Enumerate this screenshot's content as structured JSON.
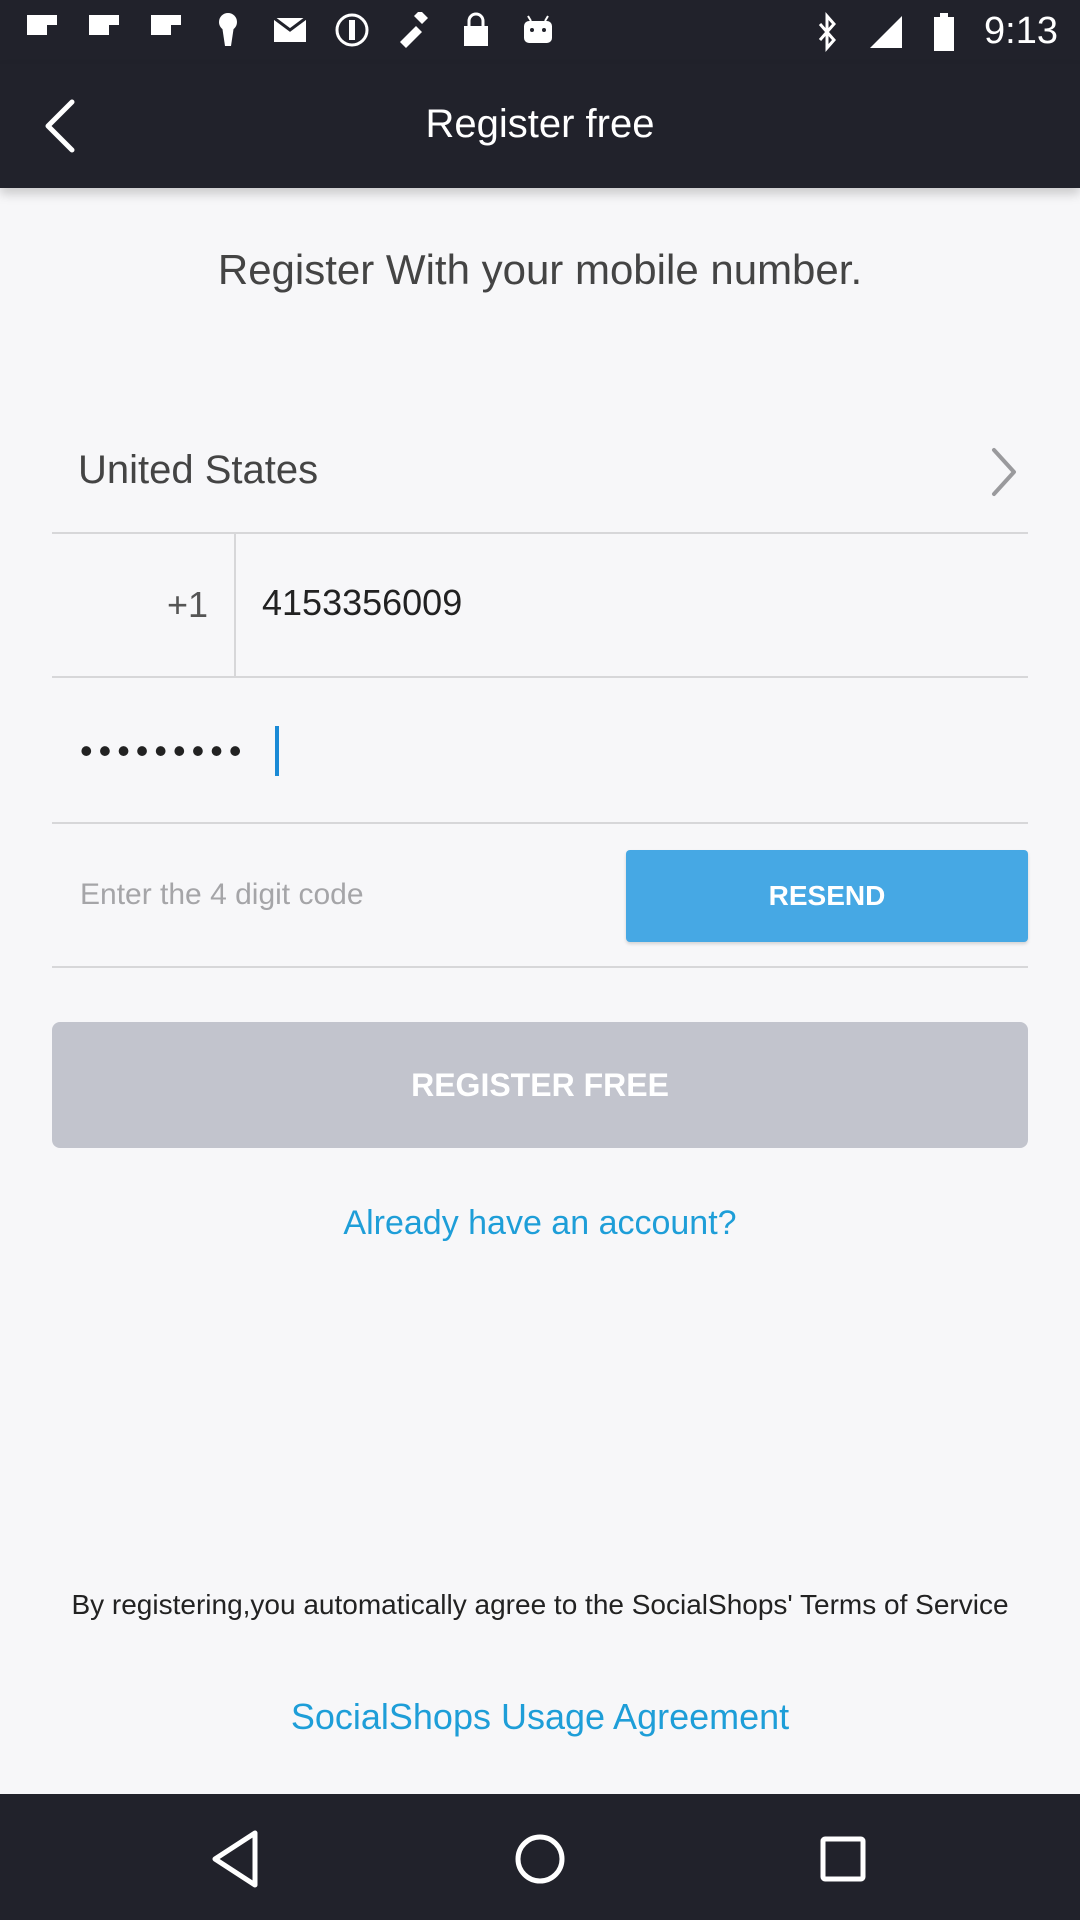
{
  "status_bar": {
    "time": "9:13",
    "left_icons": [
      "flipboard-icon",
      "flipboard-icon",
      "flipboard-icon",
      "keyhole-icon",
      "mail-icon",
      "data-saver-icon",
      "fake-gps-icon",
      "lock-icon",
      "android-icon"
    ],
    "right_icons": [
      "bluetooth-icon",
      "signal-icon",
      "battery-icon"
    ]
  },
  "toolbar": {
    "title": "Register free"
  },
  "form": {
    "subtitle": "Register With your mobile number.",
    "country": "United States",
    "country_code": "+1",
    "phone_value": "4153356009",
    "password_value": "•••••••••",
    "code_placeholder": "Enter the 4 digit code",
    "resend_label": "RESEND",
    "register_label": "REGISTER FREE",
    "already_account": "Already have an account?",
    "terms_text": "By registering,you automatically agree to the SocialShops' Terms of Service",
    "agreement_link": "SocialShops Usage Agreement"
  },
  "colors": {
    "bar_bg": "#21222b",
    "accent": "#46a8e4",
    "link": "#1e9ed8",
    "disabled_button": "#c2c4cd"
  }
}
